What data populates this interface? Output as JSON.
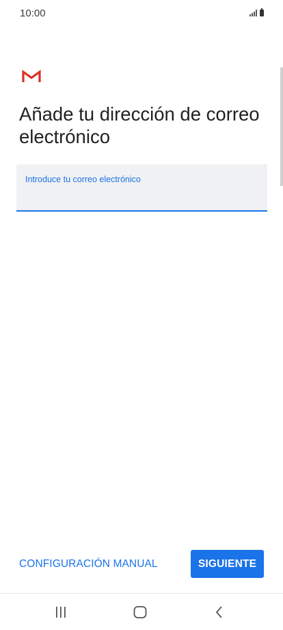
{
  "status_bar": {
    "time": "10:00",
    "signal_icon": "signal-bars-icon",
    "battery_icon": "battery-icon"
  },
  "app": {
    "logo": "gmail-m-logo",
    "title": "Añade tu dirección de correo electrónico"
  },
  "email_field": {
    "label": "Introduce tu correo electrónico",
    "value": "",
    "placeholder": ""
  },
  "actions": {
    "manual_config_label": "CONFIGURACIÓN MANUAL",
    "next_label": "SIGUIENTE"
  },
  "nav_bar": {
    "recent_icon": "recent-apps-icon",
    "home_icon": "home-icon",
    "back_icon": "back-icon"
  },
  "colors": {
    "accent": "#1a73e8",
    "field_background": "#f0f1f3",
    "gmail_red": "#d93025"
  }
}
